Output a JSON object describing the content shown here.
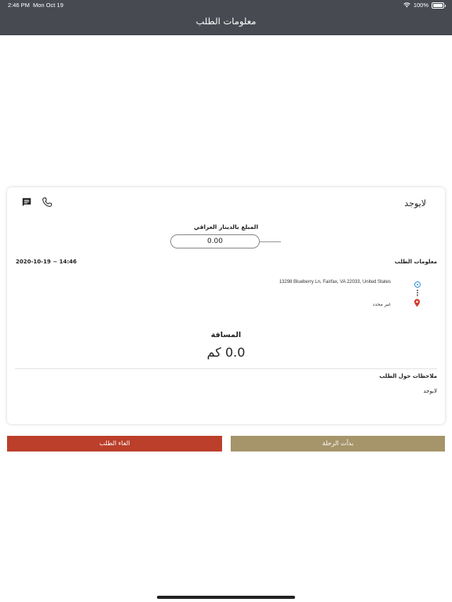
{
  "status_bar": {
    "time": "2:46 PM",
    "date": "Mon Oct 19",
    "battery": "100%"
  },
  "nav": {
    "title": "معلومات الطلب"
  },
  "card": {
    "customer_name": "لايوجد",
    "amount_label": "المبلغ بالدينار العراقي",
    "amount_value": "0.00",
    "order_info_label": "معلومات الطلب",
    "order_datetime": "2020-10-19 ~ 14:46",
    "pickup_address": "13298 Blueberry Ln, Fairfax, VA  22033, United States",
    "dropoff_address": "غير محدد",
    "distance_label": "المسافة",
    "distance_value": "0.0 كم",
    "notes_label": "ملاحظات حول الطلب",
    "notes_value": "لايوجد"
  },
  "buttons": {
    "cancel_label": "الغاء الطلب",
    "start_label": "بدأت الرحلة"
  },
  "colors": {
    "nav_bg": "#474b51",
    "cancel_bg": "#bb3f2a",
    "start_bg": "#a6946a",
    "pickup_marker": "#2d8fd5",
    "dropoff_marker": "#d13b2f"
  },
  "icons": {
    "chat": "chat-icon",
    "phone": "phone-icon",
    "wifi": "wifi-icon",
    "battery": "battery-icon",
    "pickup": "pickup-marker-icon",
    "dropoff": "dropoff-pin-icon"
  }
}
